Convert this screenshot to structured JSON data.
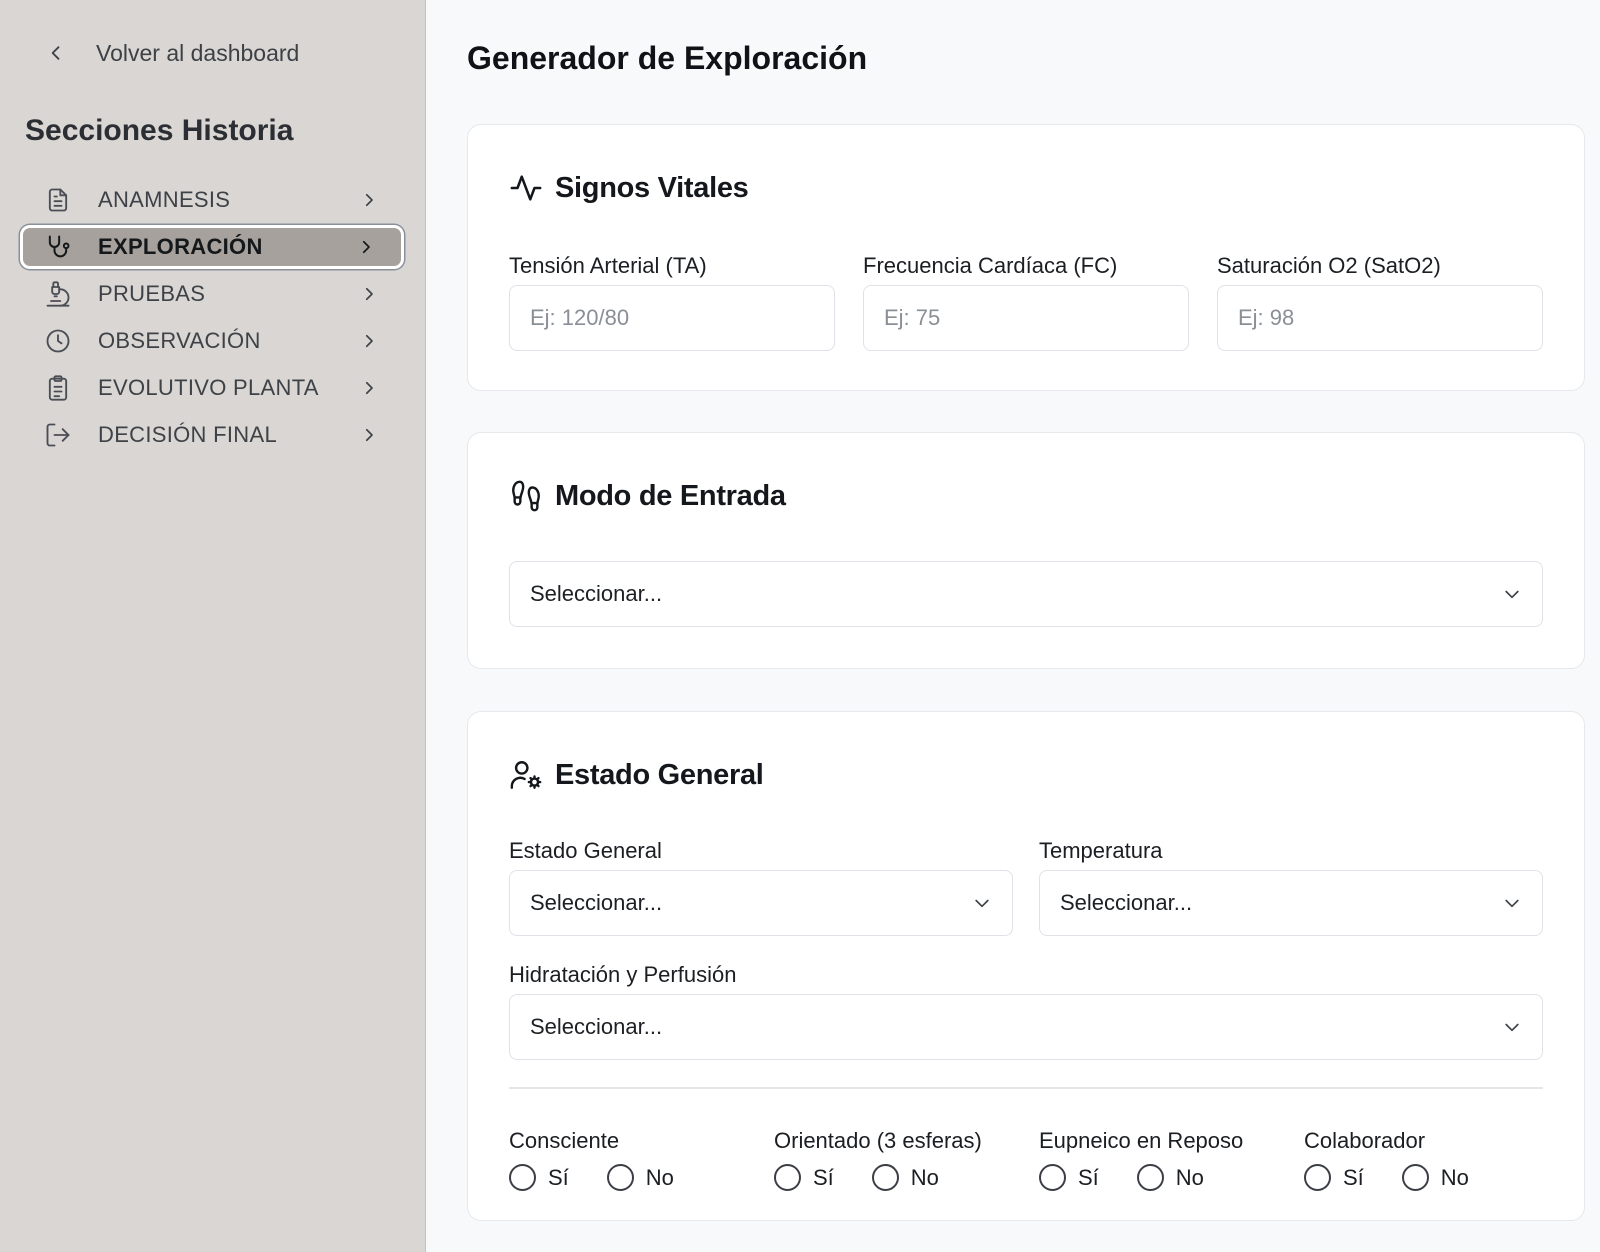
{
  "sidebar": {
    "back_label": "Volver al dashboard",
    "title": "Secciones Historia",
    "items": [
      {
        "label": "ANAMNESIS",
        "icon": "document-icon",
        "active": false
      },
      {
        "label": "EXPLORACIÓN",
        "icon": "stethoscope-icon",
        "active": true
      },
      {
        "label": "PRUEBAS",
        "icon": "microscope-icon",
        "active": false
      },
      {
        "label": "OBSERVACIÓN",
        "icon": "clock-icon",
        "active": false
      },
      {
        "label": "EVOLUTIVO PLANTA",
        "icon": "clipboard-icon",
        "active": false
      },
      {
        "label": "DECISIÓN FINAL",
        "icon": "exit-icon",
        "active": false
      }
    ]
  },
  "page": {
    "title": "Generador de Exploración"
  },
  "vitals": {
    "title": "Signos Vitales",
    "icon": "activity-icon",
    "fields": [
      {
        "label": "Tensión Arterial (TA)",
        "placeholder": "Ej: 120/80",
        "value": ""
      },
      {
        "label": "Frecuencia Cardíaca (FC)",
        "placeholder": "Ej: 75",
        "value": ""
      },
      {
        "label": "Saturación O2 (SatO2)",
        "placeholder": "Ej: 98",
        "value": ""
      }
    ]
  },
  "entry": {
    "title": "Modo de Entrada",
    "icon": "footprints-icon",
    "select_value": "Seleccionar..."
  },
  "general": {
    "title": "Estado General",
    "icon": "user-cog-icon",
    "estado_label": "Estado General",
    "estado_value": "Seleccionar...",
    "temp_label": "Temperatura",
    "temp_value": "Seleccionar...",
    "hidra_label": "Hidratación y Perfusión",
    "hidra_value": "Seleccionar...",
    "radios": [
      {
        "label": "Consciente",
        "yes": "Sí",
        "no": "No"
      },
      {
        "label": "Orientado (3 esferas)",
        "yes": "Sí",
        "no": "No"
      },
      {
        "label": "Eupneico en Reposo",
        "yes": "Sí",
        "no": "No"
      },
      {
        "label": "Colaborador",
        "yes": "Sí",
        "no": "No"
      }
    ]
  },
  "colors": {
    "sidebar_bg": "#d9d6d4",
    "active_bg": "#a7a19d",
    "page_bg": "#f8f9fb"
  }
}
